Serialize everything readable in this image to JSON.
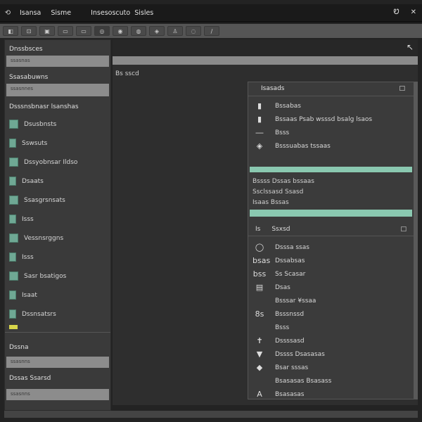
{
  "topbar": {
    "app_icon": "app-icon",
    "menu": [
      "Isansa",
      "Sisme",
      "Insesoscuto",
      "Sisles"
    ],
    "controls": [
      "Ꮼ",
      "✕"
    ]
  },
  "toolbar": {
    "buttons": [
      "◧",
      "⊡",
      "▣",
      "▭",
      "▭",
      "◎",
      "◉",
      "◍",
      "◈",
      "♙",
      "◌",
      "∕"
    ]
  },
  "sidebar": {
    "header": "Dnssbsces",
    "field1": "ssasnas",
    "label2": "Ssasabuwns",
    "field2": "ssasnnes",
    "group_title": "Dsssnsbnasr lsanshas",
    "items": [
      "Dsusbnsts",
      "Sswsuts",
      "Dssyobnsar Ildso",
      "Dsaats",
      "Ssasgrsnsats",
      "Isss",
      "Vessnsrggns",
      "Isss",
      "Sasr bsatigos",
      "Isaat",
      "Dssnsatsrs"
    ],
    "footer_label": "Dssna",
    "footer_field": "ssasnns",
    "footer_item": "Dssas Ssarsd",
    "footer_field2": "ssasnns"
  },
  "main": {
    "crumb": "Bs sscd",
    "collapse_icon": "↖"
  },
  "panel": {
    "title": "Isasads",
    "close": "□",
    "props": [
      {
        "icon": "▮",
        "label": "Bssabas"
      },
      {
        "icon": "▮",
        "label": "Bssaas Psab wsssd bsalg lsaos"
      },
      {
        "icon": "―",
        "label": "Bsss"
      },
      {
        "icon": "◈",
        "label": "Bsssuabas tssaas"
      }
    ],
    "lines": [
      "Bssss Dssas bssaas",
      "Ssclssasd Ssasd",
      "Isaas Bssas"
    ],
    "section": {
      "icon": "Is",
      "label": "Ssxsd",
      "caret": "□"
    },
    "items": [
      {
        "icon": "◯",
        "label": "Dsssa ssas"
      },
      {
        "icon": "bsas",
        "label": "Dssabsas"
      },
      {
        "icon": "bss",
        "label": "Ss Scasar"
      },
      {
        "icon": "▤",
        "label": "Dsas"
      },
      {
        "icon": "",
        "label": "Bsssar ¥ssaa"
      },
      {
        "icon": "8s",
        "label": "Bsssnssd"
      },
      {
        "icon": "",
        "label": "Bsss"
      },
      {
        "icon": "✝",
        "label": "Dssssasd"
      },
      {
        "icon": "▼",
        "label": "Dssss Dsasasas"
      },
      {
        "icon": "◆",
        "label": "Bsar sssas"
      },
      {
        "icon": "",
        "label": "Bsasasas Bsasass"
      },
      {
        "icon": "A",
        "label": "Bsasasas"
      }
    ]
  }
}
